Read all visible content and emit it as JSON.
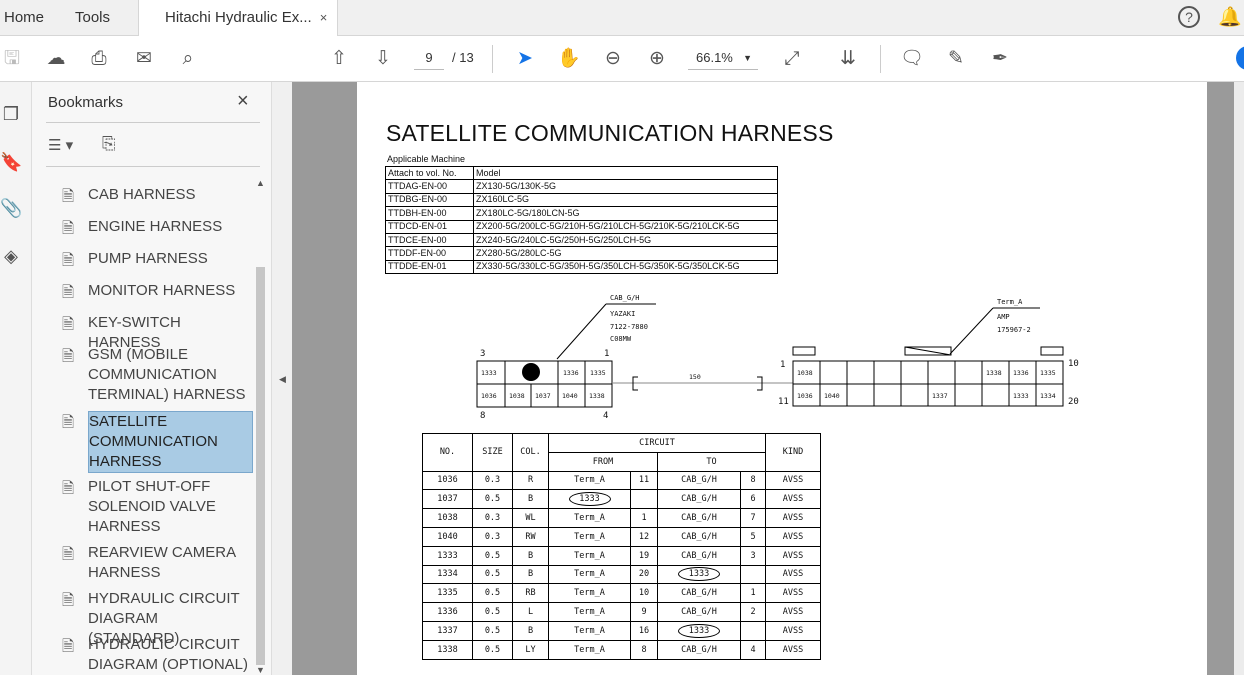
{
  "tabs": {
    "home": "Home",
    "tools": "Tools",
    "doc": "Hitachi Hydraulic Ex...",
    "close": "×"
  },
  "toolbar": {
    "page_current": "9",
    "page_total": "/ 13",
    "zoom": "66.1%"
  },
  "panel": {
    "title": "Bookmarks",
    "close": "×",
    "items": [
      {
        "label": "CAB HARNESS"
      },
      {
        "label": "ENGINE HARNESS"
      },
      {
        "label": "PUMP HARNESS"
      },
      {
        "label": "MONITOR HARNESS"
      },
      {
        "label": "KEY-SWITCH HARNESS"
      },
      {
        "label": "GSM (MOBILE COMMUNICATION TERMINAL) HARNESS"
      },
      {
        "label": "SATELLITE COMMUNICATION HARNESS",
        "selected": true
      },
      {
        "label": "PILOT SHUT-OFF SOLENOID VALVE HARNESS"
      },
      {
        "label": "REARVIEW CAMERA HARNESS"
      },
      {
        "label": "HYDRAULIC CIRCUIT DIAGRAM (STANDARD)"
      },
      {
        "label": "HYDRAULIC CIRCUIT DIAGRAM (OPTIONAL)"
      }
    ]
  },
  "doc": {
    "title": "SATELLITE COMMUNICATION HARNESS",
    "applicable_label": "Applicable Machine",
    "machine_headers": [
      "Attach to vol. No.",
      "Model"
    ],
    "machines": [
      [
        "TTDAG-EN-00",
        "ZX130-5G/130K-5G"
      ],
      [
        "TTDBG-EN-00",
        "ZX160LC-5G"
      ],
      [
        "TTDBH-EN-00",
        "ZX180LC-5G/180LCN-5G"
      ],
      [
        "TTDCD-EN-01",
        "ZX200-5G/200LC-5G/210H-5G/210LCH-5G/210K-5G/210LCK-5G"
      ],
      [
        "TTDCE-EN-00",
        "ZX240-5G/240LC-5G/250H-5G/250LCH-5G"
      ],
      [
        "TTDDF-EN-00",
        "ZX280-5G/280LC-5G"
      ],
      [
        "TTDDE-EN-01",
        "ZX330-5G/330LC-5G/350H-5G/350LCH-5G/350K-5G/350LCK-5G"
      ]
    ],
    "cab": {
      "name": "CAB_G/H",
      "maker": "YAZAKI",
      "part": "7122-7880",
      "type": "C08MW",
      "pin_tl": "3",
      "pin_tr": "1",
      "pin_bl": "8",
      "pin_br": "4",
      "top": [
        "1333",
        "",
        "1336",
        "1335"
      ],
      "bottom": [
        "1036",
        "1038",
        "1037",
        "1040",
        "1338"
      ]
    },
    "wire_length": "150",
    "term": {
      "name": "Term_A",
      "maker": "AMP",
      "part": "175967-2",
      "pin_tl": "1",
      "pin_bl": "11",
      "pin_tr": "10",
      "pin_br": "20",
      "top": [
        "1038",
        "",
        "",
        "",
        "",
        "",
        "",
        "1338",
        "1336",
        "1335"
      ],
      "bottom": [
        "1036",
        "1040",
        "",
        "",
        "",
        "1337",
        "",
        "",
        "1333",
        "1334"
      ]
    },
    "circuit_headers": {
      "no": "NO.",
      "size": "SIZE",
      "col": "COL.",
      "circuit": "CIRCUIT",
      "from": "FROM",
      "to": "TO",
      "kind": "KIND"
    },
    "circuits": [
      {
        "no": "1036",
        "size": "0.3",
        "col": "R",
        "from": "Term_A",
        "fp": "11",
        "to": "CAB_G/H",
        "tp": "8",
        "kind": "AVSS"
      },
      {
        "no": "1037",
        "size": "0.5",
        "col": "B",
        "from": "1333",
        "from_oval": true,
        "fp": "",
        "to": "CAB_G/H",
        "tp": "6",
        "kind": "AVSS"
      },
      {
        "no": "1038",
        "size": "0.3",
        "col": "WL",
        "from": "Term_A",
        "fp": "1",
        "to": "CAB_G/H",
        "tp": "7",
        "kind": "AVSS"
      },
      {
        "no": "1040",
        "size": "0.3",
        "col": "RW",
        "from": "Term_A",
        "fp": "12",
        "to": "CAB_G/H",
        "tp": "5",
        "kind": "AVSS"
      },
      {
        "no": "1333",
        "size": "0.5",
        "col": "B",
        "from": "Term_A",
        "fp": "19",
        "to": "CAB_G/H",
        "tp": "3",
        "kind": "AVSS"
      },
      {
        "no": "1334",
        "size": "0.5",
        "col": "B",
        "from": "Term_A",
        "fp": "20",
        "to": "1333",
        "to_oval": true,
        "tp": "",
        "kind": "AVSS"
      },
      {
        "no": "1335",
        "size": "0.5",
        "col": "RB",
        "from": "Term_A",
        "fp": "10",
        "to": "CAB_G/H",
        "tp": "1",
        "kind": "AVSS"
      },
      {
        "no": "1336",
        "size": "0.5",
        "col": "L",
        "from": "Term_A",
        "fp": "9",
        "to": "CAB_G/H",
        "tp": "2",
        "kind": "AVSS"
      },
      {
        "no": "1337",
        "size": "0.5",
        "col": "B",
        "from": "Term_A",
        "fp": "16",
        "to": "1333",
        "to_oval": true,
        "tp": "",
        "kind": "AVSS"
      },
      {
        "no": "1338",
        "size": "0.5",
        "col": "LY",
        "from": "Term_A",
        "fp": "8",
        "to": "CAB_G/H",
        "tp": "4",
        "kind": "AVSS"
      }
    ]
  }
}
